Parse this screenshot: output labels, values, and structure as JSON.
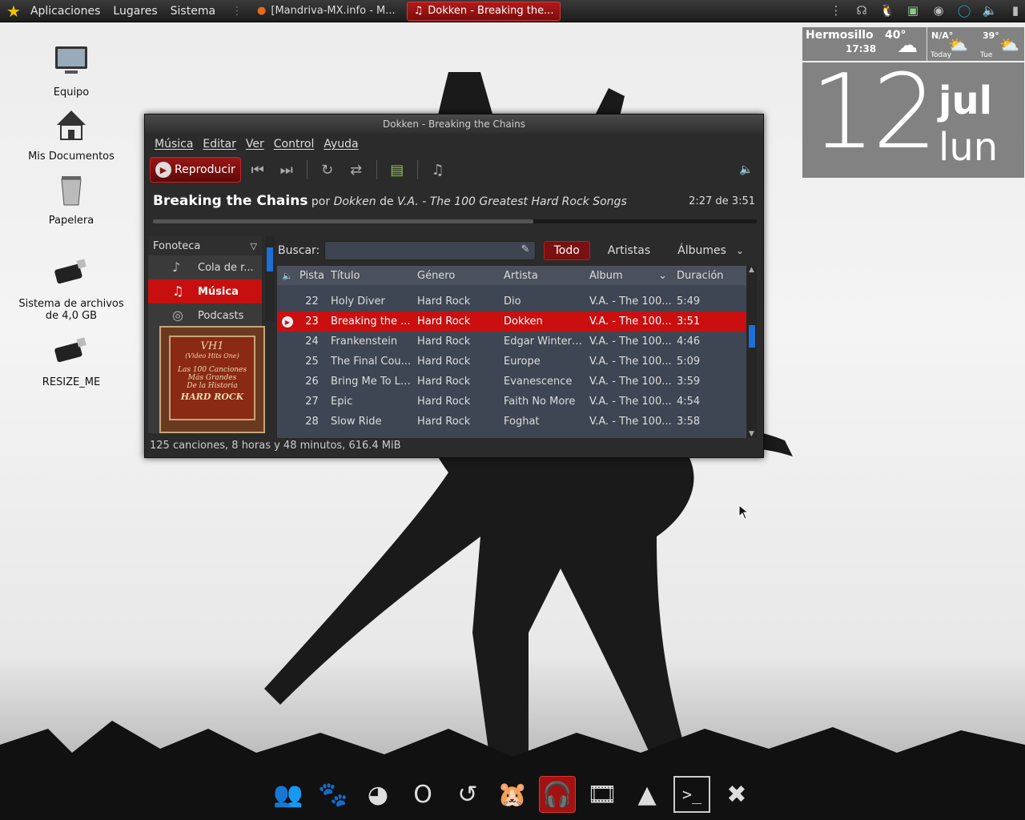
{
  "top_panel": {
    "menus": [
      "Aplicaciones",
      "Lugares",
      "Sistema"
    ],
    "tasks": [
      {
        "label": "[Mandriva-MX.info - M...",
        "active": false
      },
      {
        "label": "Dokken - Breaking the...",
        "active": true
      }
    ]
  },
  "desktop_icons": [
    {
      "name": "computer",
      "label": "Equipo"
    },
    {
      "name": "home",
      "label": "Mis Documentos"
    },
    {
      "name": "trash",
      "label": "Papelera"
    },
    {
      "name": "usb-drive",
      "label": "Sistema de archivos de 4,0 GB"
    },
    {
      "name": "usb-drive",
      "label": "RESIZE_ME"
    }
  ],
  "weather": {
    "city": "Hermosillo",
    "time": "17:38",
    "temp_now": "40°",
    "today_label": "Today",
    "today_temp": "N/A°",
    "tue_label": "Tue",
    "tue_temp": "39°"
  },
  "clock": {
    "day": "12",
    "month": "jul",
    "weekday": "lun"
  },
  "window": {
    "title": "Dokken - Breaking the Chains",
    "menu": [
      "Música",
      "Editar",
      "Ver",
      "Control",
      "Ayuda"
    ],
    "play_label": "Reproducir",
    "now_playing": {
      "song": "Breaking the Chains",
      "by": "por",
      "artist": "Dokken",
      "from": "de",
      "album": "V.A. - The 100 Greatest Hard Rock Songs"
    },
    "time_display": "2:27 de 3:51",
    "progress": 0.63,
    "sidebar": {
      "header": "Fonoteca",
      "sources": [
        {
          "label": "Cola de r...",
          "active": false
        },
        {
          "label": "Música",
          "active": true
        },
        {
          "label": "Podcasts",
          "active": false
        }
      ]
    },
    "album_art": {
      "line1": "VH1",
      "line2": "(Video Hits One)",
      "line3": "Las 100 Canciones",
      "line4": "Más Grandes",
      "line5": "De la Historia",
      "line6": "HARD ROCK"
    },
    "search_label": "Buscar:",
    "search_value": "",
    "filters": [
      {
        "label": "Todo",
        "active": true
      },
      {
        "label": "Artistas",
        "active": false
      },
      {
        "label": "Álbumes",
        "active": false
      }
    ],
    "columns": [
      "Pista",
      "Título",
      "Género",
      "Artista",
      "Álbum",
      "Duración"
    ],
    "tracks": [
      {
        "num": "22",
        "title": "Holy Diver",
        "genre": "Hard Rock",
        "artist": "Dio",
        "album": "V.A. - The 100...",
        "duration": "5:49",
        "playing": false
      },
      {
        "num": "23",
        "title": "Breaking the ...",
        "genre": "Hard Rock",
        "artist": "Dokken",
        "album": "V.A. - The 100...",
        "duration": "3:51",
        "playing": true
      },
      {
        "num": "24",
        "title": "Frankenstein",
        "genre": "Hard Rock",
        "artist": "Edgar Winter ...",
        "album": "V.A. - The 100...",
        "duration": "4:46",
        "playing": false
      },
      {
        "num": "25",
        "title": "The Final Cou...",
        "genre": "Hard Rock",
        "artist": "Europe",
        "album": "V.A. - The 100...",
        "duration": "5:09",
        "playing": false
      },
      {
        "num": "26",
        "title": "Bring Me To Life",
        "genre": "Hard Rock",
        "artist": "Evanescence",
        "album": "V.A. - The 100...",
        "duration": "3:59",
        "playing": false
      },
      {
        "num": "27",
        "title": "Epic",
        "genre": "Hard Rock",
        "artist": "Faith No More",
        "album": "V.A. - The 100...",
        "duration": "4:54",
        "playing": false
      },
      {
        "num": "28",
        "title": "Slow Ride",
        "genre": "Hard Rock",
        "artist": "Foghat",
        "album": "V.A. - The 100...",
        "duration": "3:58",
        "playing": false
      }
    ],
    "status": "125 canciones, 8 horas y 48 minutos, 616.4 MiB"
  },
  "dock": [
    "people-icon",
    "gimp-icon",
    "firefox-icon",
    "opera-icon",
    "refresh-icon",
    "pidgin-icon",
    "rhythmbox-icon",
    "video-icon",
    "vlc-icon",
    "terminal-icon",
    "settings-icon"
  ],
  "colors": {
    "accent": "#c80f0f",
    "panel": "#2a2a2a",
    "list_bg": "#3f4653"
  }
}
